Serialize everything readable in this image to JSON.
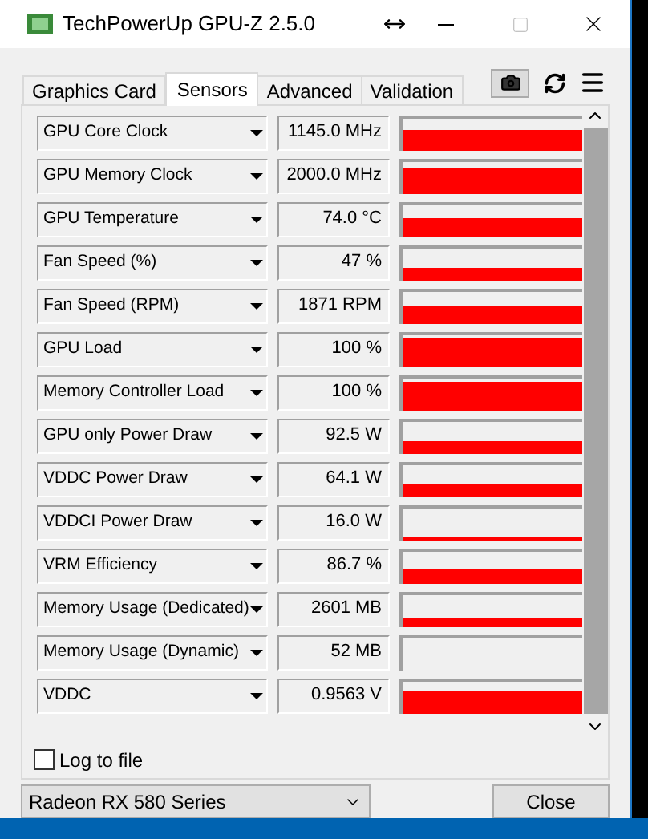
{
  "window": {
    "title": "TechPowerUp GPU-Z 2.5.0"
  },
  "tabs": [
    {
      "label": "Graphics Card",
      "selected": false
    },
    {
      "label": "Sensors",
      "selected": true
    },
    {
      "label": "Advanced",
      "selected": false
    },
    {
      "label": "Validation",
      "selected": false
    }
  ],
  "sensors": [
    {
      "name": "GPU Core Clock",
      "value": "1145.0 MHz"
    },
    {
      "name": "GPU Memory Clock",
      "value": "2000.0 MHz"
    },
    {
      "name": "GPU Temperature",
      "value": "74.0 °C"
    },
    {
      "name": "Fan Speed (%)",
      "value": "47 %"
    },
    {
      "name": "Fan Speed (RPM)",
      "value": "1871 RPM"
    },
    {
      "name": "GPU Load",
      "value": "100 %"
    },
    {
      "name": "Memory Controller Load",
      "value": "100 %"
    },
    {
      "name": "GPU only Power Draw",
      "value": "92.5 W"
    },
    {
      "name": "VDDC Power Draw",
      "value": "64.1 W"
    },
    {
      "name": "VDDCI Power Draw",
      "value": "16.0 W"
    },
    {
      "name": "VRM Efficiency",
      "value": "86.7 %"
    },
    {
      "name": "Memory Usage (Dedicated)",
      "value": "2601 MB"
    },
    {
      "name": "Memory Usage (Dynamic)",
      "value": "52 MB"
    },
    {
      "name": "VDDC",
      "value": "0.9563 V"
    }
  ],
  "log_to_file": {
    "label": "Log to file",
    "checked": false
  },
  "gpu_select": {
    "value": "Radeon RX 580 Series"
  },
  "close_button": "Close"
}
